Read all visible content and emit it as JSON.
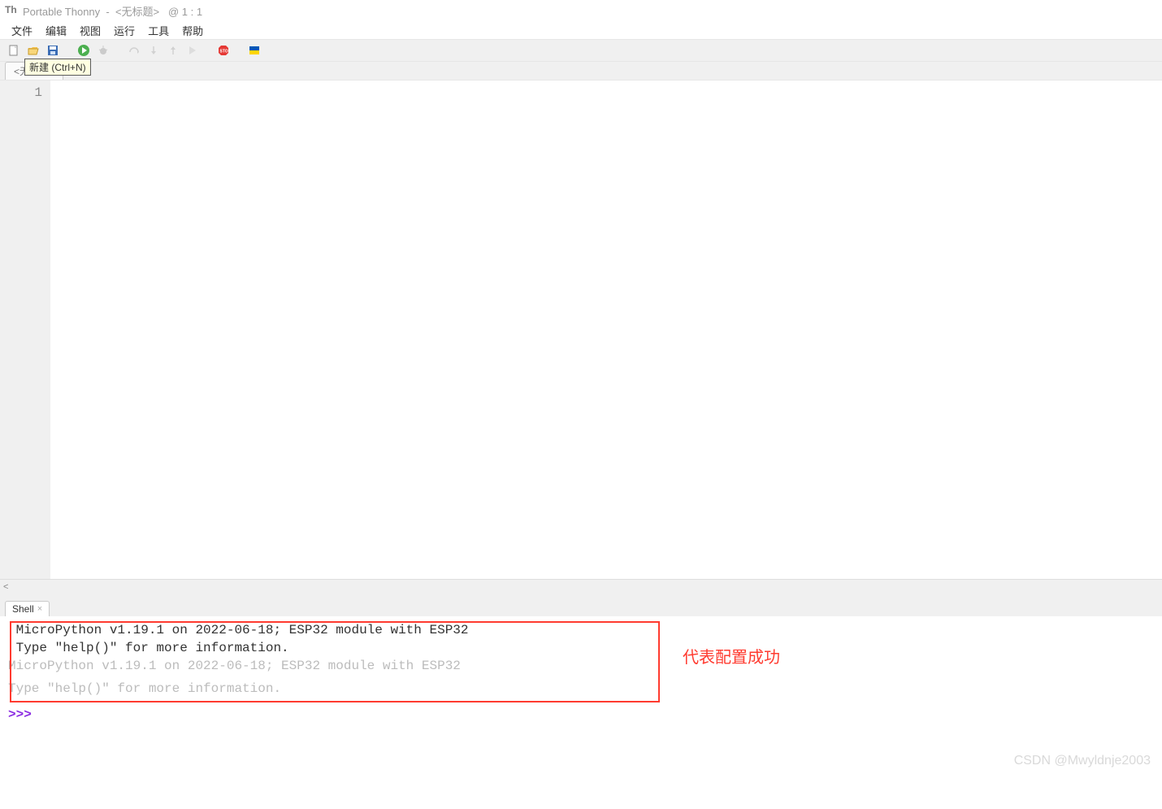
{
  "titlebar": {
    "app": "Portable Thonny",
    "doc": "<无标题>",
    "pos": "@  1 : 1"
  },
  "menubar": {
    "items": [
      "文件",
      "编辑",
      "视图",
      "运行",
      "工具",
      "帮助"
    ]
  },
  "tooltip": "新建 (Ctrl+N)",
  "editor": {
    "tab_label": "<无标题>",
    "line_number": "1"
  },
  "hscroll_hint": "<",
  "shell": {
    "tab_label": "Shell",
    "lines": [
      {
        "text": " MicroPython v1.19.1 on 2022-06-18; ESP32 module with ESP32",
        "cls": ""
      },
      {
        "text": " Type \"help()\" for more information.",
        "cls": ""
      },
      {
        "text": "MicroPython v1.19.1 on 2022-06-18; ESP32 module with ESP32",
        "cls": "grey"
      },
      {
        "text": "Type \"help()\" for more information.",
        "cls": "grey"
      }
    ],
    "prompt": ">>> "
  },
  "annotation": "代表配置成功",
  "watermark": "CSDN @Mwyldnje2003"
}
